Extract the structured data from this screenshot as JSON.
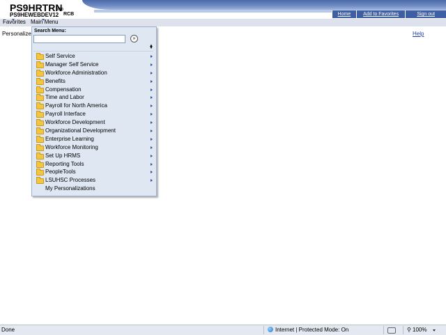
{
  "header": {
    "db_name": "PS9HRTRN",
    "db_version": "9.50",
    "server_name": "PS9HEWEBDEV12",
    "user_id": "RCB",
    "links": [
      "Home",
      "Add to Favorites",
      "Sign out"
    ]
  },
  "menubar": {
    "favorites": "Favorites",
    "main_menu": "Main Menu"
  },
  "page": {
    "personalize": "Personalize",
    "help": "Help"
  },
  "dropdown": {
    "search_label": "Search Menu:",
    "search_value": "",
    "go_symbol": "»",
    "items": [
      {
        "label": "Self Service",
        "folder": true,
        "submenu": true
      },
      {
        "label": "Manager Self Service",
        "folder": true,
        "submenu": true
      },
      {
        "label": "Workforce Administration",
        "folder": true,
        "submenu": true
      },
      {
        "label": "Benefits",
        "folder": true,
        "submenu": true
      },
      {
        "label": "Compensation",
        "folder": true,
        "submenu": true
      },
      {
        "label": "Time and Labor",
        "folder": true,
        "submenu": true
      },
      {
        "label": "Payroll for North America",
        "folder": true,
        "submenu": true
      },
      {
        "label": "Payroll Interface",
        "folder": true,
        "submenu": true
      },
      {
        "label": "Workforce Development",
        "folder": true,
        "submenu": true
      },
      {
        "label": "Organizational Development",
        "folder": true,
        "submenu": true
      },
      {
        "label": "Enterprise Learning",
        "folder": true,
        "submenu": true
      },
      {
        "label": "Workforce Monitoring",
        "folder": true,
        "submenu": true
      },
      {
        "label": "Set Up HRMS",
        "folder": true,
        "submenu": true
      },
      {
        "label": "Reporting Tools",
        "folder": true,
        "submenu": true
      },
      {
        "label": "PeopleTools",
        "folder": true,
        "submenu": true
      },
      {
        "label": "LSUHSC Processes",
        "folder": true,
        "submenu": true
      },
      {
        "label": "My Personalizations",
        "folder": false,
        "submenu": false
      }
    ]
  },
  "statusbar": {
    "status": "Done",
    "zone": "Internet | Protected Mode: On",
    "zoom": "100%"
  }
}
